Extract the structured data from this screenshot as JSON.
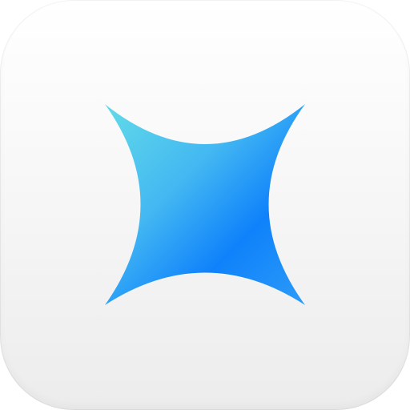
{
  "app_icon": {
    "name": "four-point-star-icon",
    "colors": {
      "tile_top": "#ffffff",
      "tile_bottom": "#ececec",
      "star_light": "#5cd6ea",
      "star_mid": "#35a8f5",
      "star_dark": "#0a7dff"
    }
  }
}
